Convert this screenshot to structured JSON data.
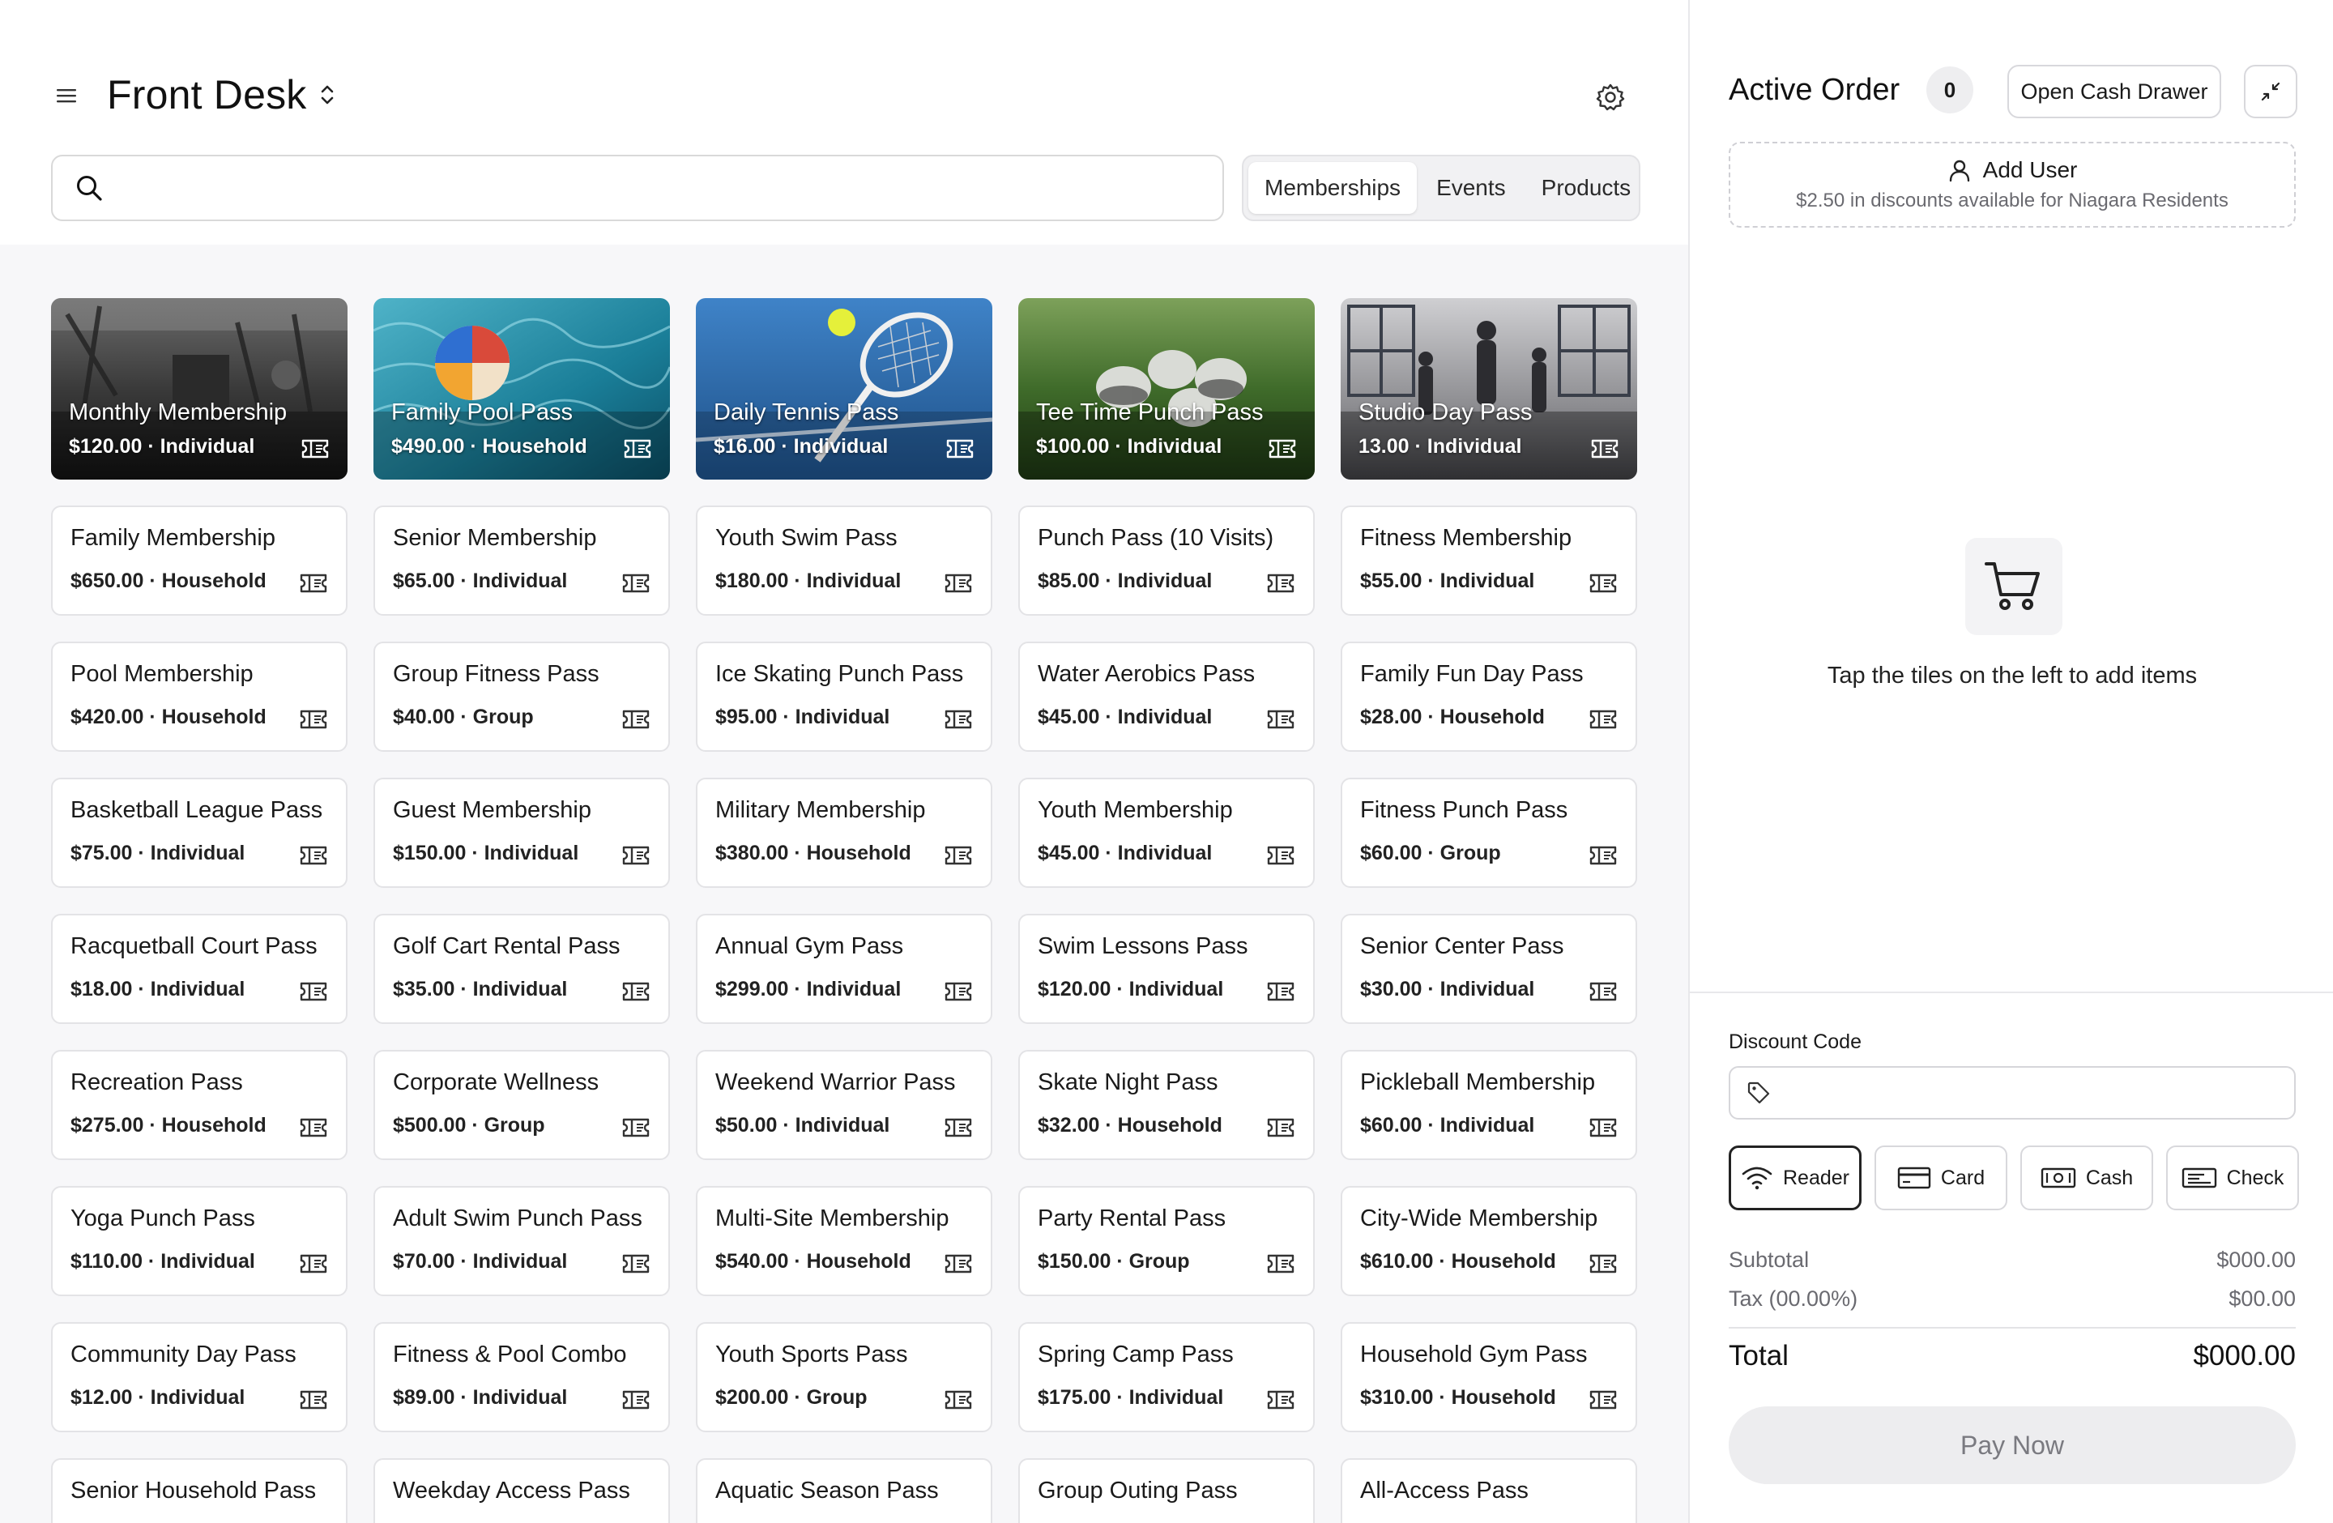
{
  "header": {
    "title": "Front Desk"
  },
  "search": {
    "placeholder": ""
  },
  "tabs": [
    {
      "label": "Memberships",
      "active": true
    },
    {
      "label": "Events",
      "active": false
    },
    {
      "label": "Products",
      "active": false
    }
  ],
  "featured": [
    {
      "name": "Monthly Membership",
      "meta": "$120.00 · Individual",
      "theme": "gym"
    },
    {
      "name": "Family Pool Pass",
      "meta": "$490.00 · Household",
      "theme": "pool"
    },
    {
      "name": "Daily Tennis Pass",
      "meta": "$16.00 · Individual",
      "theme": "tennis"
    },
    {
      "name": "Tee Time Punch Pass",
      "meta": "$100.00 · Individual",
      "theme": "golf"
    },
    {
      "name": "Studio Day Pass",
      "meta": "13.00 · Individual",
      "theme": "studio"
    }
  ],
  "items": [
    {
      "name": "Family Membership",
      "meta": "$650.00 · Household"
    },
    {
      "name": "Senior Membership",
      "meta": "$65.00 · Individual"
    },
    {
      "name": "Youth Swim Pass",
      "meta": "$180.00 · Individual"
    },
    {
      "name": "Punch Pass (10 Visits)",
      "meta": "$85.00 · Individual"
    },
    {
      "name": "Fitness Membership",
      "meta": "$55.00 · Individual"
    },
    {
      "name": "Pool Membership",
      "meta": "$420.00 · Household"
    },
    {
      "name": "Group Fitness Pass",
      "meta": "$40.00 · Group"
    },
    {
      "name": "Ice Skating Punch Pass",
      "meta": "$95.00 · Individual"
    },
    {
      "name": "Water Aerobics Pass",
      "meta": "$45.00 · Individual"
    },
    {
      "name": "Family Fun Day Pass",
      "meta": "$28.00 · Household"
    },
    {
      "name": "Basketball League Pass",
      "meta": "$75.00 · Individual"
    },
    {
      "name": "Guest Membership",
      "meta": "$150.00 · Individual"
    },
    {
      "name": "Military Membership",
      "meta": "$380.00 · Household"
    },
    {
      "name": "Youth Membership",
      "meta": "$45.00 · Individual"
    },
    {
      "name": "Fitness Punch Pass",
      "meta": "$60.00 · Group"
    },
    {
      "name": "Racquetball Court Pass",
      "meta": "$18.00 · Individual"
    },
    {
      "name": "Golf Cart Rental Pass",
      "meta": "$35.00 · Individual"
    },
    {
      "name": "Annual Gym Pass",
      "meta": "$299.00 · Individual"
    },
    {
      "name": "Swim Lessons Pass",
      "meta": "$120.00 · Individual"
    },
    {
      "name": "Senior Center Pass",
      "meta": "$30.00 · Individual"
    },
    {
      "name": "Recreation Pass",
      "meta": "$275.00 · Household"
    },
    {
      "name": "Corporate Wellness",
      "meta": "$500.00 · Group"
    },
    {
      "name": "Weekend Warrior Pass",
      "meta": "$50.00 · Individual"
    },
    {
      "name": "Skate Night Pass",
      "meta": "$32.00 · Household"
    },
    {
      "name": "Pickleball Membership",
      "meta": "$60.00 · Individual"
    },
    {
      "name": "Yoga Punch Pass",
      "meta": "$110.00 · Individual"
    },
    {
      "name": "Adult Swim Punch Pass",
      "meta": "$70.00 · Individual"
    },
    {
      "name": "Multi-Site Membership",
      "meta": "$540.00 · Household"
    },
    {
      "name": "Party Rental Pass",
      "meta": "$150.00 · Group"
    },
    {
      "name": "City-Wide Membership",
      "meta": "$610.00 · Household"
    },
    {
      "name": "Community Day Pass",
      "meta": "$12.00 · Individual"
    },
    {
      "name": "Fitness & Pool Combo",
      "meta": "$89.00 · Individual"
    },
    {
      "name": "Youth Sports Pass",
      "meta": "$200.00 · Group"
    },
    {
      "name": "Spring Camp Pass",
      "meta": "$175.00 · Individual"
    },
    {
      "name": "Household Gym Pass",
      "meta": "$310.00 · Household"
    },
    {
      "name": "Senior Household Pass",
      "meta": ""
    },
    {
      "name": "Weekday Access Pass",
      "meta": ""
    },
    {
      "name": "Aquatic Season Pass",
      "meta": ""
    },
    {
      "name": "Group Outing Pass",
      "meta": ""
    },
    {
      "name": "All-Access Pass",
      "meta": ""
    }
  ],
  "order": {
    "title": "Active Order",
    "count": "0",
    "open_drawer_label": "Open Cash Drawer",
    "add_user_label": "Add User",
    "discount_note": "$2.50 in discounts available for Niagara Residents",
    "empty_message": "Tap the tiles on the left to add items",
    "discount_code_label": "Discount Code",
    "discount_code_placeholder": "",
    "payment_methods": [
      {
        "label": "Reader",
        "icon": "wifi-icon",
        "active": true
      },
      {
        "label": "Card",
        "icon": "card-icon",
        "active": false
      },
      {
        "label": "Cash",
        "icon": "cash-icon",
        "active": false
      },
      {
        "label": "Check",
        "icon": "check-icon",
        "active": false
      }
    ],
    "subtotal_label": "Subtotal",
    "subtotal_value": "$000.00",
    "tax_label": "Tax (00.00%)",
    "tax_value": "$00.00",
    "total_label": "Total",
    "total_value": "$000.00",
    "pay_label": "Pay Now"
  }
}
